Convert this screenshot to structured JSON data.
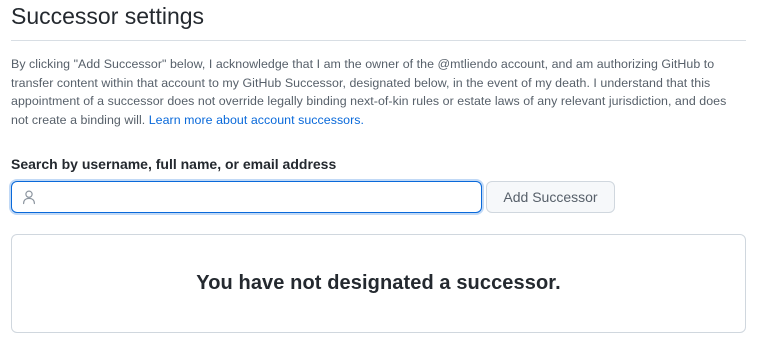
{
  "page": {
    "title": "Successor settings"
  },
  "description": {
    "text": "By clicking \"Add Successor\" below, I acknowledge that I am the owner of the @mtliendo account, and am authorizing GitHub to transfer content within that account to my GitHub Successor, designated below, in the event of my death. I understand that this appointment of a successor does not override legally binding next-of-kin rules or estate laws of any relevant jurisdiction, and does not create a binding will.",
    "link_label": "Learn more about account successors."
  },
  "search": {
    "label": "Search by username, full name, or email address",
    "value": "",
    "placeholder": "",
    "icon": "person-icon"
  },
  "actions": {
    "add_label": "Add Successor"
  },
  "empty_state": {
    "message": "You have not designated a successor."
  },
  "colors": {
    "link": "#0969da",
    "focus": "#0969da",
    "text": "#24292f",
    "muted": "#57606a"
  }
}
